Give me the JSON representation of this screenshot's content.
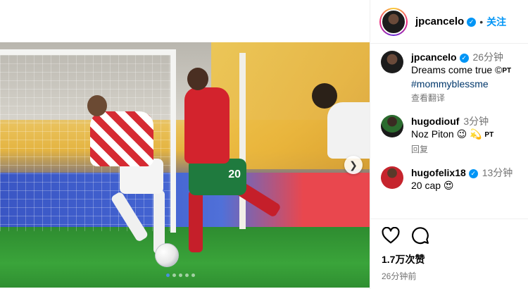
{
  "header": {
    "username": "jpcancelo",
    "separator": "•",
    "follow_label": "关注"
  },
  "comments": [
    {
      "username": "jpcancelo",
      "time": "26分钟",
      "text": "Dreams come true ©",
      "text_suffix": "PT",
      "hashtag": "#mommyblessme",
      "meta": "查看翻译",
      "verified": true
    },
    {
      "username": "hugodiouf",
      "time": "3分钟",
      "text": "Noz Piton 😉 💫",
      "text_suffix": "PT",
      "meta": "回复",
      "verified": false
    },
    {
      "username": "hugofelix18",
      "time": "13分钟",
      "text": "20 cap 😍",
      "verified": true
    }
  ],
  "post": {
    "likes": "1.7万次赞",
    "time_ago": "26分钟前",
    "player_number": "20"
  },
  "carousel": {
    "dots": 5,
    "active_index": 0
  },
  "colors": {
    "accent": "#0095f6",
    "link": "#00376b",
    "muted": "#737373"
  }
}
